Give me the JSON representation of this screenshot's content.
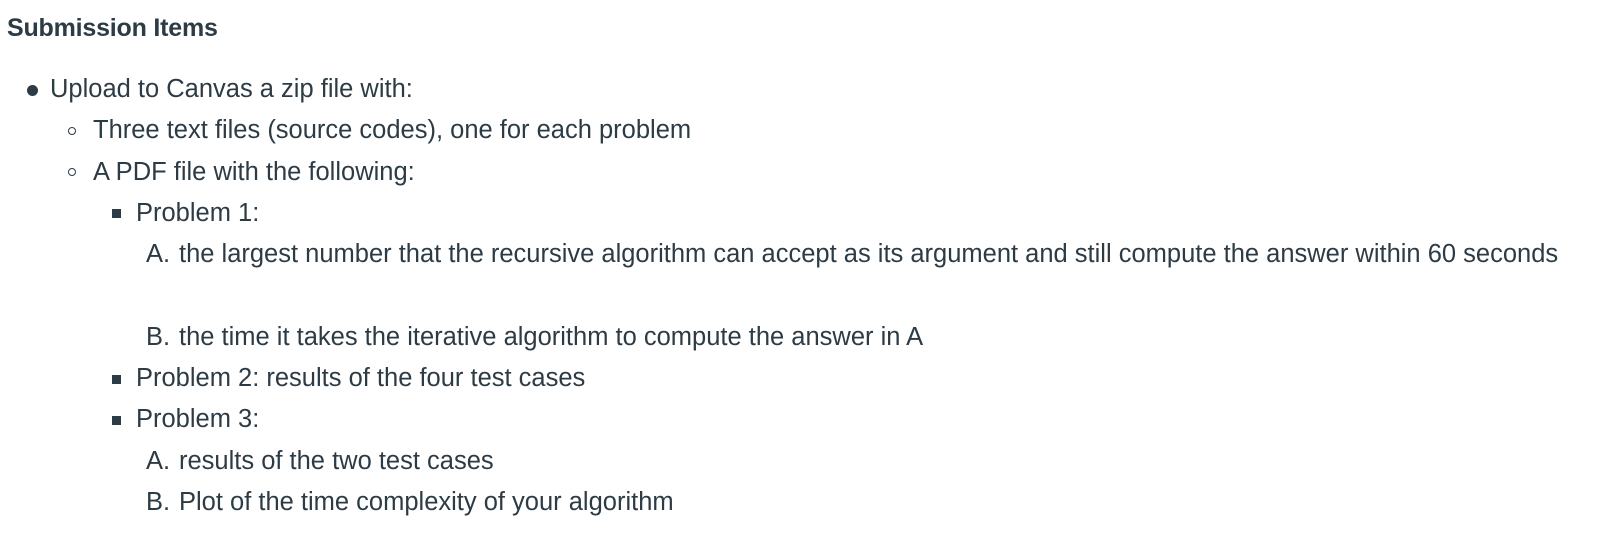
{
  "heading": "Submission Items",
  "items": {
    "upload": "Upload to Canvas a zip file with:",
    "text_files": "Three text files (source codes), one for each problem",
    "pdf_file": "A PDF file with the following:",
    "problem1": "Problem 1:",
    "problem1_a_marker": "A.",
    "problem1_a": "the largest number that the recursive algorithm can accept as its argument and still compute the answer within 60 seconds",
    "problem1_b_marker": "B.",
    "problem1_b": "the time it takes the iterative algorithm to compute the answer in A",
    "problem2": "Problem 2: results of the four test cases",
    "problem3": "Problem 3:",
    "problem3_a_marker": "A.",
    "problem3_a": "results of the two test cases",
    "problem3_b_marker": "B.",
    "problem3_b": "Plot of the time complexity of your algorithm"
  }
}
